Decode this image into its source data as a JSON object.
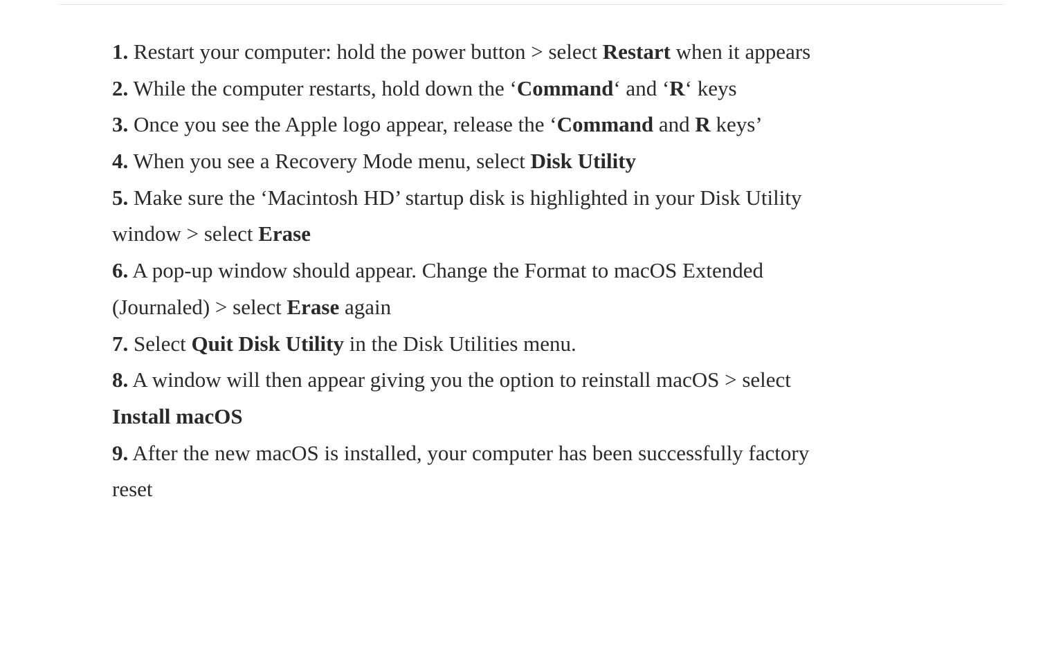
{
  "steps": [
    {
      "num": "1.",
      "parts": [
        {
          "text": " Restart your computer: hold the power button > select "
        },
        {
          "text": "Restart",
          "bold": true
        },
        {
          "text": " when it appears"
        }
      ]
    },
    {
      "num": "2.",
      "parts": [
        {
          "text": " While the computer restarts, hold down the ‘"
        },
        {
          "text": "Command",
          "bold": true
        },
        {
          "text": "‘ and ‘"
        },
        {
          "text": "R",
          "bold": true
        },
        {
          "text": "‘ keys"
        }
      ]
    },
    {
      "num": "3.",
      "parts": [
        {
          "text": " Once you see the Apple logo appear, release the ‘"
        },
        {
          "text": "Command",
          "bold": true
        },
        {
          "text": " and "
        },
        {
          "text": "R",
          "bold": true
        },
        {
          "text": " keys’"
        }
      ]
    },
    {
      "num": "4.",
      "parts": [
        {
          "text": " When you see a Recovery Mode menu, select "
        },
        {
          "text": "Disk Utility",
          "bold": true
        }
      ]
    },
    {
      "num": "5.",
      "parts": [
        {
          "text": " Make sure the ‘Macintosh HD’ startup disk is highlighted in your Disk Utility window > select "
        },
        {
          "text": "Erase",
          "bold": true
        }
      ]
    },
    {
      "num": "6.",
      "parts": [
        {
          "text": " A pop-up window should appear. Change the Format to macOS Extended (Journaled) > select "
        },
        {
          "text": "Erase",
          "bold": true
        },
        {
          "text": " again"
        }
      ]
    },
    {
      "num": "7.",
      "parts": [
        {
          "text": " Select "
        },
        {
          "text": "Quit Disk Utility",
          "bold": true
        },
        {
          "text": " in the Disk Utilities menu."
        }
      ]
    },
    {
      "num": "8.",
      "parts": [
        {
          "text": " A window will then appear giving you the option to reinstall macOS > select "
        },
        {
          "text": "Install macOS",
          "bold": true
        }
      ]
    },
    {
      "num": "9.",
      "parts": [
        {
          "text": " After the new macOS is installed, your computer has been successfully factory reset"
        }
      ]
    }
  ]
}
